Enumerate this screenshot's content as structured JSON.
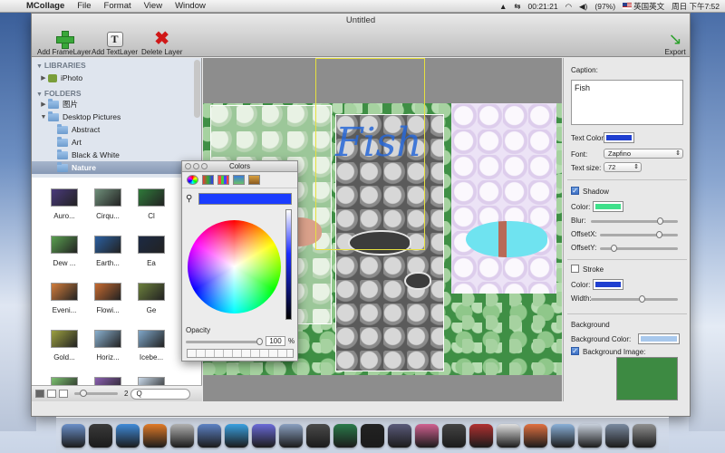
{
  "menubar": {
    "app_name": "MCollage",
    "items": [
      "File",
      "Format",
      "View",
      "Window"
    ],
    "status": {
      "time": "00:21:21",
      "battery": "(97%)",
      "input_method": "英国英文",
      "datetime": "周日 下午7:52"
    }
  },
  "window": {
    "title": "Untitled"
  },
  "toolbar": {
    "add_frame_layer": "Add FrameLayer",
    "add_text_layer": "Add TextLayer",
    "delete_layer": "Delete Layer",
    "export": "Export"
  },
  "sidebar": {
    "libraries_header": "LIBRARIES",
    "iphoto": "iPhoto",
    "folders_header": "FOLDERS",
    "folders": [
      {
        "label": "图片"
      },
      {
        "label": "Desktop Pictures"
      },
      {
        "label": "Abstract"
      },
      {
        "label": "Art"
      },
      {
        "label": "Black & White"
      },
      {
        "label": "Nature"
      }
    ],
    "thumbnails": [
      {
        "label": "Auro...",
        "color": "#4a3a7c"
      },
      {
        "label": "Cirqu...",
        "color": "#6f8f7a"
      },
      {
        "label": "Cl",
        "color": "#2f7a3a"
      },
      {
        "label": "Dew ...",
        "color": "#5aa050"
      },
      {
        "label": "Earth...",
        "color": "#2b5fa0"
      },
      {
        "label": "Ea",
        "color": "#1c2a44"
      },
      {
        "label": "Eveni...",
        "color": "#d27d3c"
      },
      {
        "label": "Flowi...",
        "color": "#c66a30"
      },
      {
        "label": "Ge",
        "color": "#6b7f3c"
      },
      {
        "label": "Gold...",
        "color": "#9ca040"
      },
      {
        "label": "Horiz...",
        "color": "#8ab0cf"
      },
      {
        "label": "Icebe...",
        "color": "#7fa6c8"
      },
      {
        "label": "",
        "color": "#7cc070"
      },
      {
        "label": "",
        "color": "#8a5fb0"
      },
      {
        "label": "",
        "color": "#c8d8e8"
      }
    ],
    "zoom_value": "2",
    "search_value": "Q"
  },
  "canvas": {
    "caption_text": "Fish"
  },
  "inspector": {
    "caption_label": "Caption:",
    "caption_value": "Fish",
    "text_color_label": "Text Color:",
    "text_color": "#1f3fd0",
    "font_label": "Font:",
    "font_value": "Zapfino",
    "text_size_label": "Text size:",
    "text_size_value": "72",
    "shadow_label": "Shadow",
    "shadow_checked": true,
    "color_label": "Color:",
    "shadow_color": "#3ee08a",
    "blur_label": "Blur:",
    "blur_value": 0.82,
    "offsetx_label": "OffsetX:",
    "offsetx_value": 0.78,
    "offsety_label": "OffsetY:",
    "offsety_value": 0.15,
    "stroke_label": "Stroke",
    "stroke_checked": false,
    "stroke_color_label": "Color:",
    "stroke_color": "#1f3fd0",
    "width_label": "Width:",
    "width_value": 0.6,
    "background_header": "Background",
    "background_color_label": "Background Color:",
    "background_color": "#a8c8ec",
    "background_image_label": "Background Image:",
    "background_image_checked": true
  },
  "colors_panel": {
    "title": "Colors",
    "current_color": "#1a3cff",
    "opacity_label": "Opacity",
    "opacity_value": "100",
    "opacity_unit": "%"
  }
}
